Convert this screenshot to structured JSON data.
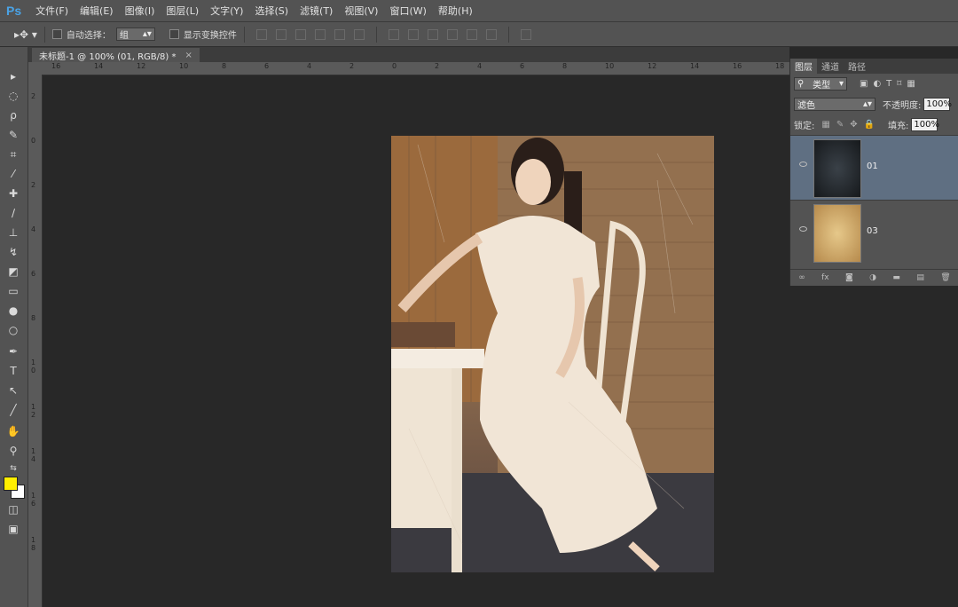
{
  "app": {
    "logo": "Ps"
  },
  "menu": [
    "文件(F)",
    "编辑(E)",
    "图像(I)",
    "图层(L)",
    "文字(Y)",
    "选择(S)",
    "滤镜(T)",
    "视图(V)",
    "窗口(W)",
    "帮助(H)"
  ],
  "options": {
    "auto_select_label": "自动选择：",
    "auto_select_value": "组",
    "show_transform_label": "显示变换控件"
  },
  "document": {
    "tab_title": "未标题-1 @ 100% (01, RGB/8) *",
    "close_glyph": "×"
  },
  "rulers": {
    "horizontal": [
      "16",
      "14",
      "12",
      "10",
      "8",
      "6",
      "4",
      "2",
      "0",
      "2",
      "4",
      "6",
      "8",
      "10",
      "12",
      "14",
      "16",
      "18"
    ],
    "vertical": [
      "2",
      "0",
      "2",
      "4",
      "6",
      "8",
      "1 0",
      "1 2",
      "1 4",
      "1 6",
      "1 8"
    ]
  },
  "colors": {
    "foreground": "#ffef00",
    "background": "#ffffff",
    "accent": "#4aa3e6"
  },
  "layers_panel": {
    "tabs": [
      "图层",
      "通道",
      "路径"
    ],
    "filter_kind": "类型",
    "blend_mode": "滤色",
    "opacity_label": "不透明度:",
    "opacity_value": "100%",
    "lock_label": "锁定:",
    "fill_label": "填充:",
    "fill_value": "100%",
    "layers": [
      {
        "name": "01",
        "selected": true
      },
      {
        "name": "03",
        "selected": false
      }
    ]
  },
  "tools": [
    "move-icon",
    "marquee-icon",
    "lasso-icon",
    "quick-select-icon",
    "crop-icon",
    "eyedropper-icon",
    "healing-icon",
    "brush-icon",
    "clone-stamp-icon",
    "history-brush-icon",
    "eraser-icon",
    "gradient-icon",
    "blur-icon",
    "dodge-icon",
    "pen-icon",
    "type-icon",
    "path-select-icon",
    "line-icon",
    "hand-icon",
    "zoom-icon"
  ]
}
